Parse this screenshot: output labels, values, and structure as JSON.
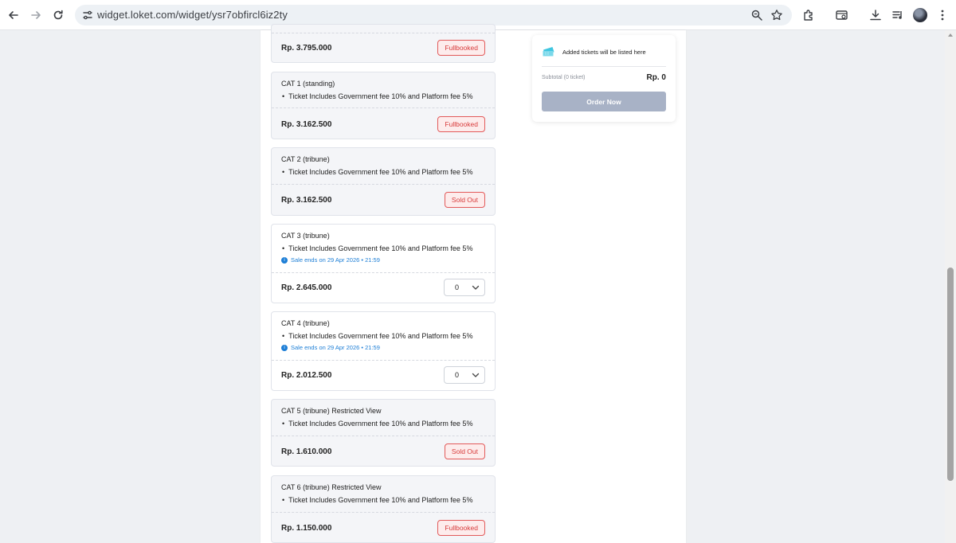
{
  "browser": {
    "url": "widget.loket.com/widget/ysr7obfircl6iz2ty"
  },
  "tickets": [
    {
      "title": "",
      "desc": "",
      "price": "Rp. 3.795.000",
      "status": "Fullbooked",
      "sale_info": "",
      "qty": ""
    },
    {
      "title": "CAT 1 (standing)",
      "desc": "Ticket Includes Government fee 10% and Platform fee 5%",
      "price": "Rp. 3.162.500",
      "status": "Fullbooked",
      "sale_info": "",
      "qty": ""
    },
    {
      "title": "CAT 2 (tribune)",
      "desc": "Ticket Includes Government fee 10% and Platform fee 5%",
      "price": "Rp. 3.162.500",
      "status": "Sold Out",
      "sale_info": "",
      "qty": ""
    },
    {
      "title": "CAT 3 (tribune)",
      "desc": "Ticket Includes Government fee 10% and Platform fee 5%",
      "price": "Rp. 2.645.000",
      "status": "",
      "sale_info": "Sale ends on 29 Apr 2026 • 21:59",
      "qty": "0"
    },
    {
      "title": "CAT 4 (tribune)",
      "desc": "Ticket Includes Government fee 10% and Platform fee 5%",
      "price": "Rp. 2.012.500",
      "status": "",
      "sale_info": "Sale ends on 29 Apr 2026 • 21:59",
      "qty": "0"
    },
    {
      "title": "CAT 5 (tribune) Restricted View",
      "desc": "Ticket Includes Government fee 10% and Platform fee 5%",
      "price": "Rp. 1.610.000",
      "status": "Sold Out",
      "sale_info": "",
      "qty": ""
    },
    {
      "title": "CAT 6 (tribune) Restricted View",
      "desc": "Ticket Includes Government fee 10% and Platform fee 5%",
      "price": "Rp. 1.150.000",
      "status": "Fullbooked",
      "sale_info": "",
      "qty": ""
    }
  ],
  "summary": {
    "empty_text": "Added tickets will be listed here",
    "subtotal_label": "Subtotal (0 ticket)",
    "subtotal_value": "Rp. 0",
    "order_button": "Order Now"
  },
  "colors": {
    "status_red": "#d83b3b",
    "sale_blue": "#1c7ed6",
    "order_disabled": "#a8b2c6",
    "ticket_icon": "#3fc6e0"
  }
}
